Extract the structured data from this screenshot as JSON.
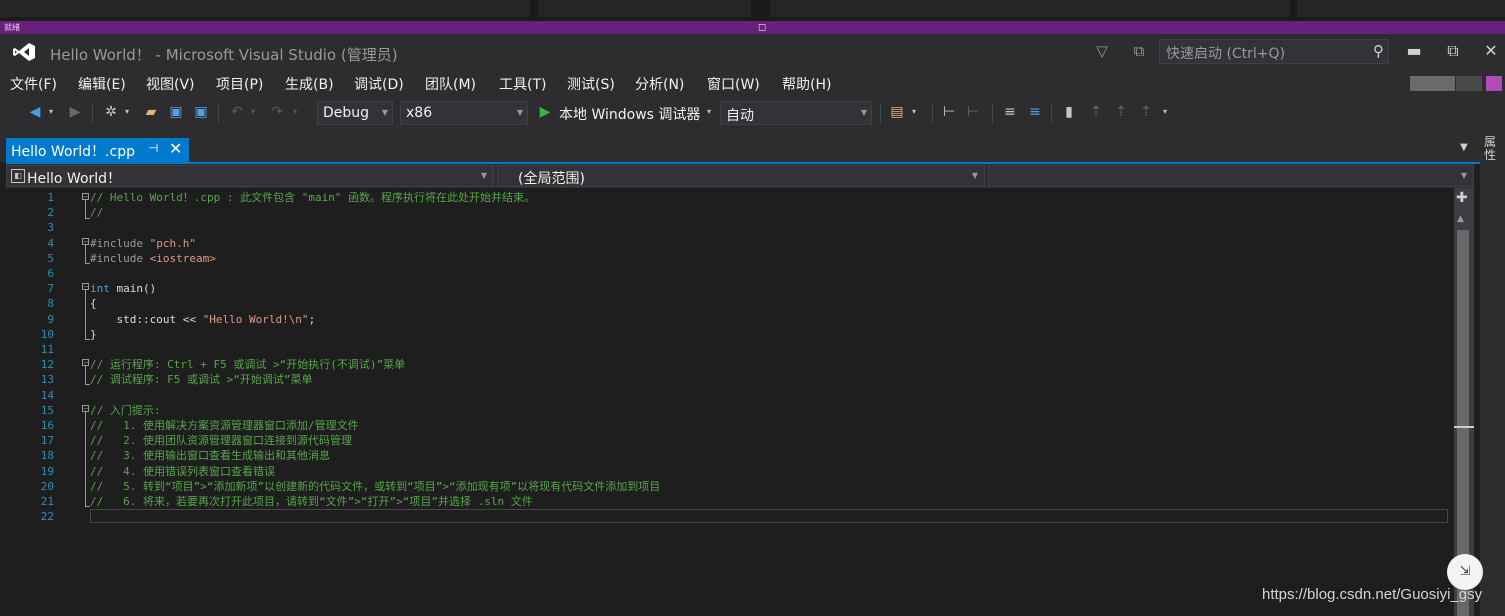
{
  "top_strip": {
    "left_label": "就绪",
    "mid_icon": "window-icon"
  },
  "window": {
    "title": "Hello World！ - Microsoft Visual Studio (管理员)",
    "quick_launch_placeholder": "快速启动 (Ctrl+Q)"
  },
  "menu": {
    "items": [
      "文件(F)",
      "编辑(E)",
      "视图(V)",
      "项目(P)",
      "生成(B)",
      "调试(D)",
      "团队(M)",
      "工具(T)",
      "测试(S)",
      "分析(N)",
      "窗口(W)",
      "帮助(H)"
    ]
  },
  "toolbar": {
    "config": "Debug",
    "platform": "x86",
    "run_label": "本地 Windows 调试器",
    "auto": "自动"
  },
  "tab": {
    "label": "Hello World！.cpp"
  },
  "side_panel": {
    "label": "属性"
  },
  "nav": {
    "project": "Hello World！",
    "scope": "(全局范围)"
  },
  "editor": {
    "line_numbers": [
      "1",
      "2",
      "3",
      "4",
      "5",
      "6",
      "7",
      "8",
      "9",
      "10",
      "11",
      "12",
      "13",
      "14",
      "15",
      "16",
      "17",
      "18",
      "19",
      "20",
      "21",
      "22"
    ],
    "lines": [
      {
        "cls": "cmt",
        "text": "// Hello World！.cpp : 此文件包含 \"main\" 函数。程序执行将在此处开始并结束。"
      },
      {
        "cls": "cmt",
        "text": "//"
      },
      {
        "cls": "",
        "text": ""
      },
      {
        "cls": "inc",
        "text": "#include ",
        "extra": "\"pch.h\"",
        "extra_cls": "str"
      },
      {
        "cls": "inc",
        "text": "#include ",
        "extra": "<iostream>",
        "extra_cls": "str"
      },
      {
        "cls": "",
        "text": ""
      },
      {
        "cls": "kw",
        "text": "int",
        "extra": " main()",
        "extra_cls": "br"
      },
      {
        "cls": "br",
        "text": "{"
      },
      {
        "cls": "br",
        "text": "    std::cout << ",
        "extra": "\"Hello World!\\n\"",
        "extra_cls": "str",
        "tail": ";"
      },
      {
        "cls": "br",
        "text": "}"
      },
      {
        "cls": "",
        "text": ""
      },
      {
        "cls": "cmt",
        "text": "// 运行程序: Ctrl + F5 或调试 >“开始执行(不调试)”菜单"
      },
      {
        "cls": "cmt",
        "text": "// 调试程序: F5 或调试 >“开始调试”菜单"
      },
      {
        "cls": "",
        "text": ""
      },
      {
        "cls": "cmt",
        "text": "// 入门提示:"
      },
      {
        "cls": "cmt",
        "text": "//   1. 使用解决方案资源管理器窗口添加/管理文件"
      },
      {
        "cls": "cmt",
        "text": "//   2. 使用团队资源管理器窗口连接到源代码管理"
      },
      {
        "cls": "cmt",
        "text": "//   3. 使用输出窗口查看生成输出和其他消息"
      },
      {
        "cls": "cmt",
        "text": "//   4. 使用错误列表窗口查看错误"
      },
      {
        "cls": "cmt",
        "text": "//   5. 转到“项目”>“添加新项”以创建新的代码文件，或转到“项目”>“添加现有项”以将现有代码文件添加到项目"
      },
      {
        "cls": "cmt",
        "text": "//   6. 将来，若要再次打开此项目，请转到“文件”>“打开”>“项目”并选择 .sln 文件"
      },
      {
        "cls": "",
        "text": ""
      }
    ]
  },
  "watermark": "https://blog.csdn.net/Guosiyi_gsy",
  "colors": {
    "accent": "#007acc",
    "purple": "#68217a",
    "comment": "#57a64a",
    "keyword": "#569cd6",
    "string": "#d69d85",
    "line_number": "#2b91af"
  }
}
